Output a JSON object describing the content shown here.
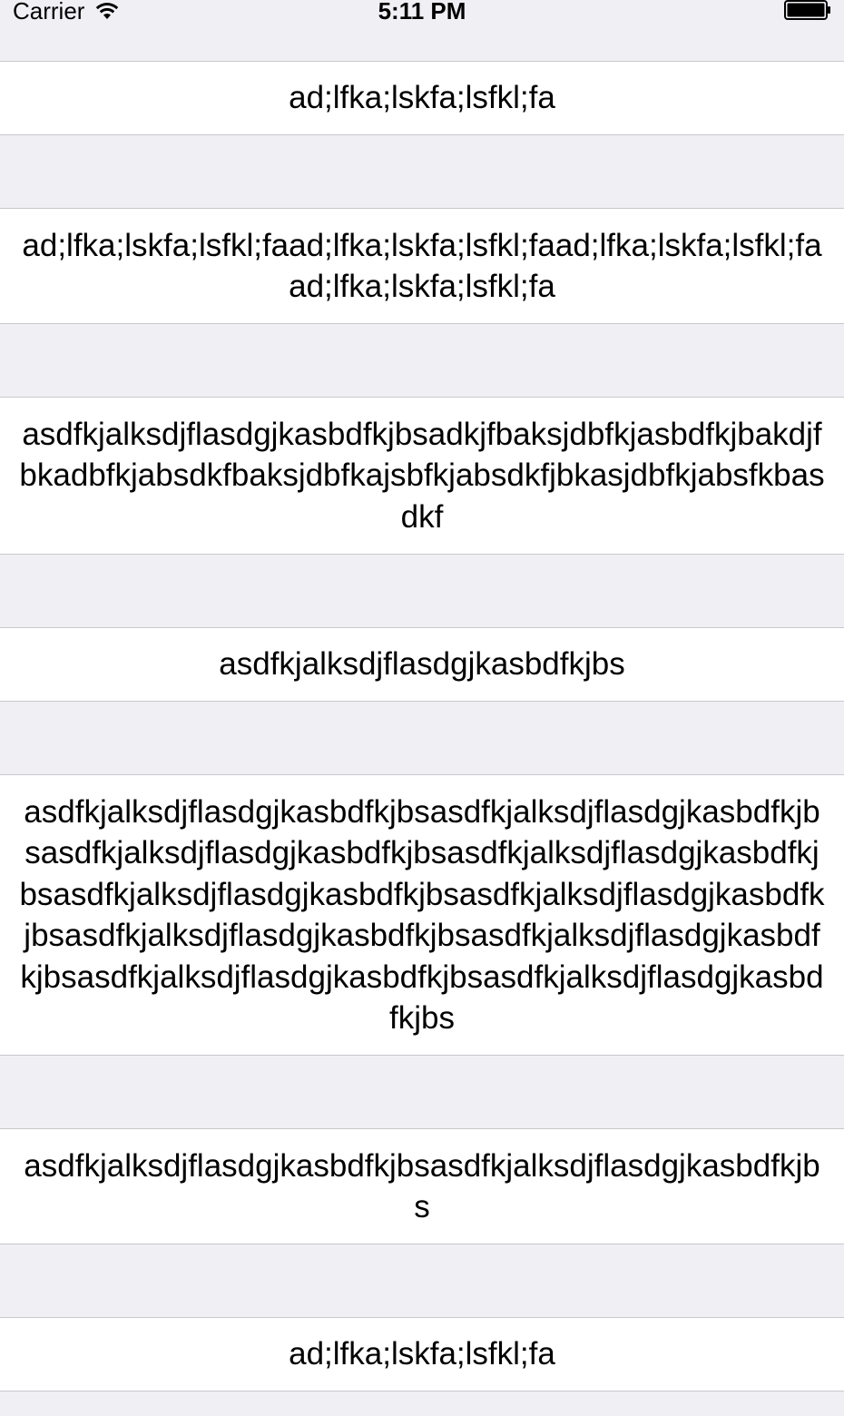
{
  "status_bar": {
    "carrier": "Carrier",
    "time": "5:11 PM",
    "icons": [
      "wifi-icon",
      "battery-icon"
    ]
  },
  "table": {
    "cells": [
      "ad;lfka;lskfa;lsfkl;fa",
      "ad;lfka;lskfa;lsfkl;faad;lfka;lskfa;lsfkl;faad;lfka;lskfa;lsfkl;faad;lfka;lskfa;lsfkl;fa",
      "asdfkjalksdjflasdgjkasbdfkjbsadkjfbaksjdbfkjasbdfkjbakdjfbkadbfkjabsdkfbaksjdbfkajsbfkjabsdkfjbkasjdbfkjabsfkbasdkf",
      "asdfkjalksdjflasdgjkasbdfkjbs",
      "asdfkjalksdjflasdgjkasbdfkjbsasdfkjalksdjflasdgjkasbdfkjbsasdfkjalksdjflasdgjkasbdfkjbsasdfkjalksdjflasdgjkasbdfkjbsasdfkjalksdjflasdgjkasbdfkjbsasdfkjalksdjflasdgjkasbdfkjbsasdfkjalksdjflasdgjkasbdfkjbsasdfkjalksdjflasdgjkasbdfkjbsasdfkjalksdjflasdgjkasbdfkjbsasdfkjalksdjflasdgjkasbdfkjbs",
      "asdfkjalksdjflasdgjkasbdfkjbsasdfkjalksdjflasdgjkasbdfkjbs",
      "ad;lfka;lskfa;lsfkl;fa"
    ]
  },
  "colors": {
    "background": "#efeff4",
    "cell": "#ffffff",
    "separator": "#c8c7cc",
    "text": "#000000"
  }
}
